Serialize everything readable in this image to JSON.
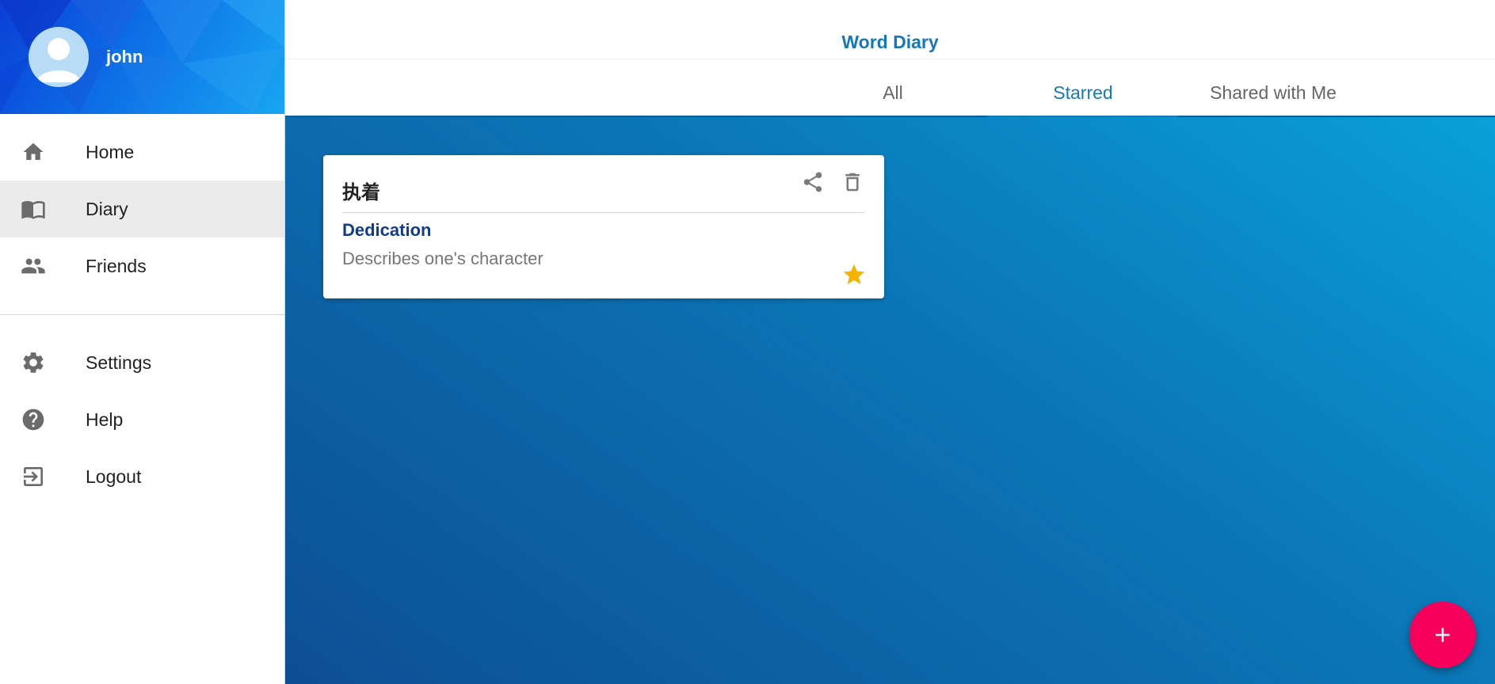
{
  "sidebar": {
    "profile": {
      "username": "john",
      "avatar_icon": "user-avatar-icon"
    },
    "items": [
      {
        "label": "Home",
        "icon": "home-icon"
      },
      {
        "label": "Diary",
        "icon": "book-icon",
        "active": true
      },
      {
        "label": "Friends",
        "icon": "people-icon"
      },
      {
        "label": "Settings",
        "icon": "gear-icon"
      },
      {
        "label": "Help",
        "icon": "help-icon"
      },
      {
        "label": "Logout",
        "icon": "logout-icon"
      }
    ]
  },
  "header": {
    "title": "Word Diary",
    "tabs": [
      {
        "label": "All"
      },
      {
        "label": "Starred",
        "active": true
      },
      {
        "label": "Shared with Me"
      }
    ]
  },
  "entries": [
    {
      "title": "执着",
      "word": "Dedication",
      "description": "Describes one's character",
      "starred": true
    }
  ],
  "fab": {
    "label": "+"
  },
  "colors": {
    "accent": "#1478bd",
    "fab": "#f5005a",
    "star": "#f5b400",
    "word": "#123b8c"
  }
}
